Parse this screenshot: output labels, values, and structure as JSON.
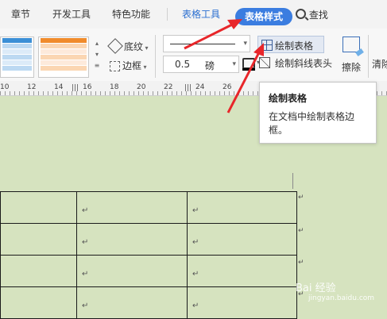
{
  "tabs": {
    "chapter": "章节",
    "dev_tools": "开发工具",
    "special": "特色功能",
    "table_tools": "表格工具",
    "table_style": "表格样式",
    "search": "查找"
  },
  "ribbon": {
    "shading": "底纹",
    "border": "边框",
    "line_weight": "0.5",
    "line_unit": "磅",
    "draw_table": "绘制表格",
    "draw_diagonal": "绘制斜线表头",
    "erase": "擦除",
    "clear": "清除",
    "style_colors": [
      "#3b8fd6",
      "#f08b2c"
    ]
  },
  "ruler": {
    "numbers": [
      "10",
      "12",
      "14",
      "16",
      "18",
      "20",
      "22",
      "24",
      "26"
    ]
  },
  "tooltip": {
    "title": "绘制表格",
    "description": "在文档中绘制表格边框。"
  },
  "doc": {
    "paragraph_mark": "↵"
  },
  "watermark": {
    "text": "Bai 经验",
    "url": "jingyan.baidu.com"
  },
  "colors": {
    "accent": "#3b7de0",
    "page_bg": "#d6e3bf",
    "arrow": "#e8262a"
  }
}
